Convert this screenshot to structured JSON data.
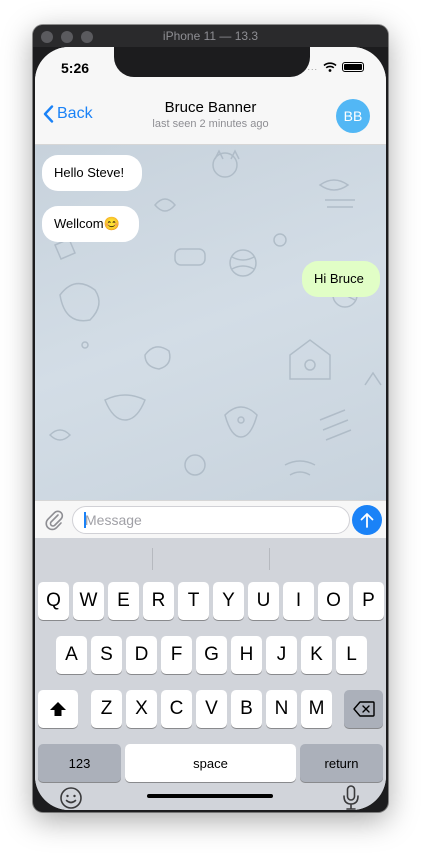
{
  "window": {
    "title": "iPhone 11 — 13.3"
  },
  "status_bar": {
    "time": "5:26",
    "signal": "....."
  },
  "nav": {
    "back_label": "Back",
    "title": "Bruce Banner",
    "subtitle": "last seen 2 minutes ago",
    "avatar_initials": "BB",
    "accent_color": "#1a82f7",
    "avatar_color": "#52b7f5"
  },
  "messages": [
    {
      "direction": "in",
      "text": "Hello Steve!"
    },
    {
      "direction": "in",
      "text": "Wellcom😊"
    },
    {
      "direction": "out",
      "text": "Hi Bruce"
    }
  ],
  "composer": {
    "placeholder": "Message"
  },
  "keyboard": {
    "row1": [
      "Q",
      "W",
      "E",
      "R",
      "T",
      "Y",
      "U",
      "I",
      "O",
      "P"
    ],
    "row2": [
      "A",
      "S",
      "D",
      "F",
      "G",
      "H",
      "J",
      "K",
      "L"
    ],
    "row3": [
      "Z",
      "X",
      "C",
      "V",
      "B",
      "N",
      "M"
    ],
    "numbers_label": "123",
    "space_label": "space",
    "return_label": "return"
  },
  "icons": {
    "back": "chevron-left-icon",
    "attach": "paperclip-icon",
    "send": "arrow-up-icon",
    "shift": "shift-icon",
    "delete": "delete-backspace-icon",
    "emoji": "emoji-icon",
    "mic": "microphone-icon"
  }
}
